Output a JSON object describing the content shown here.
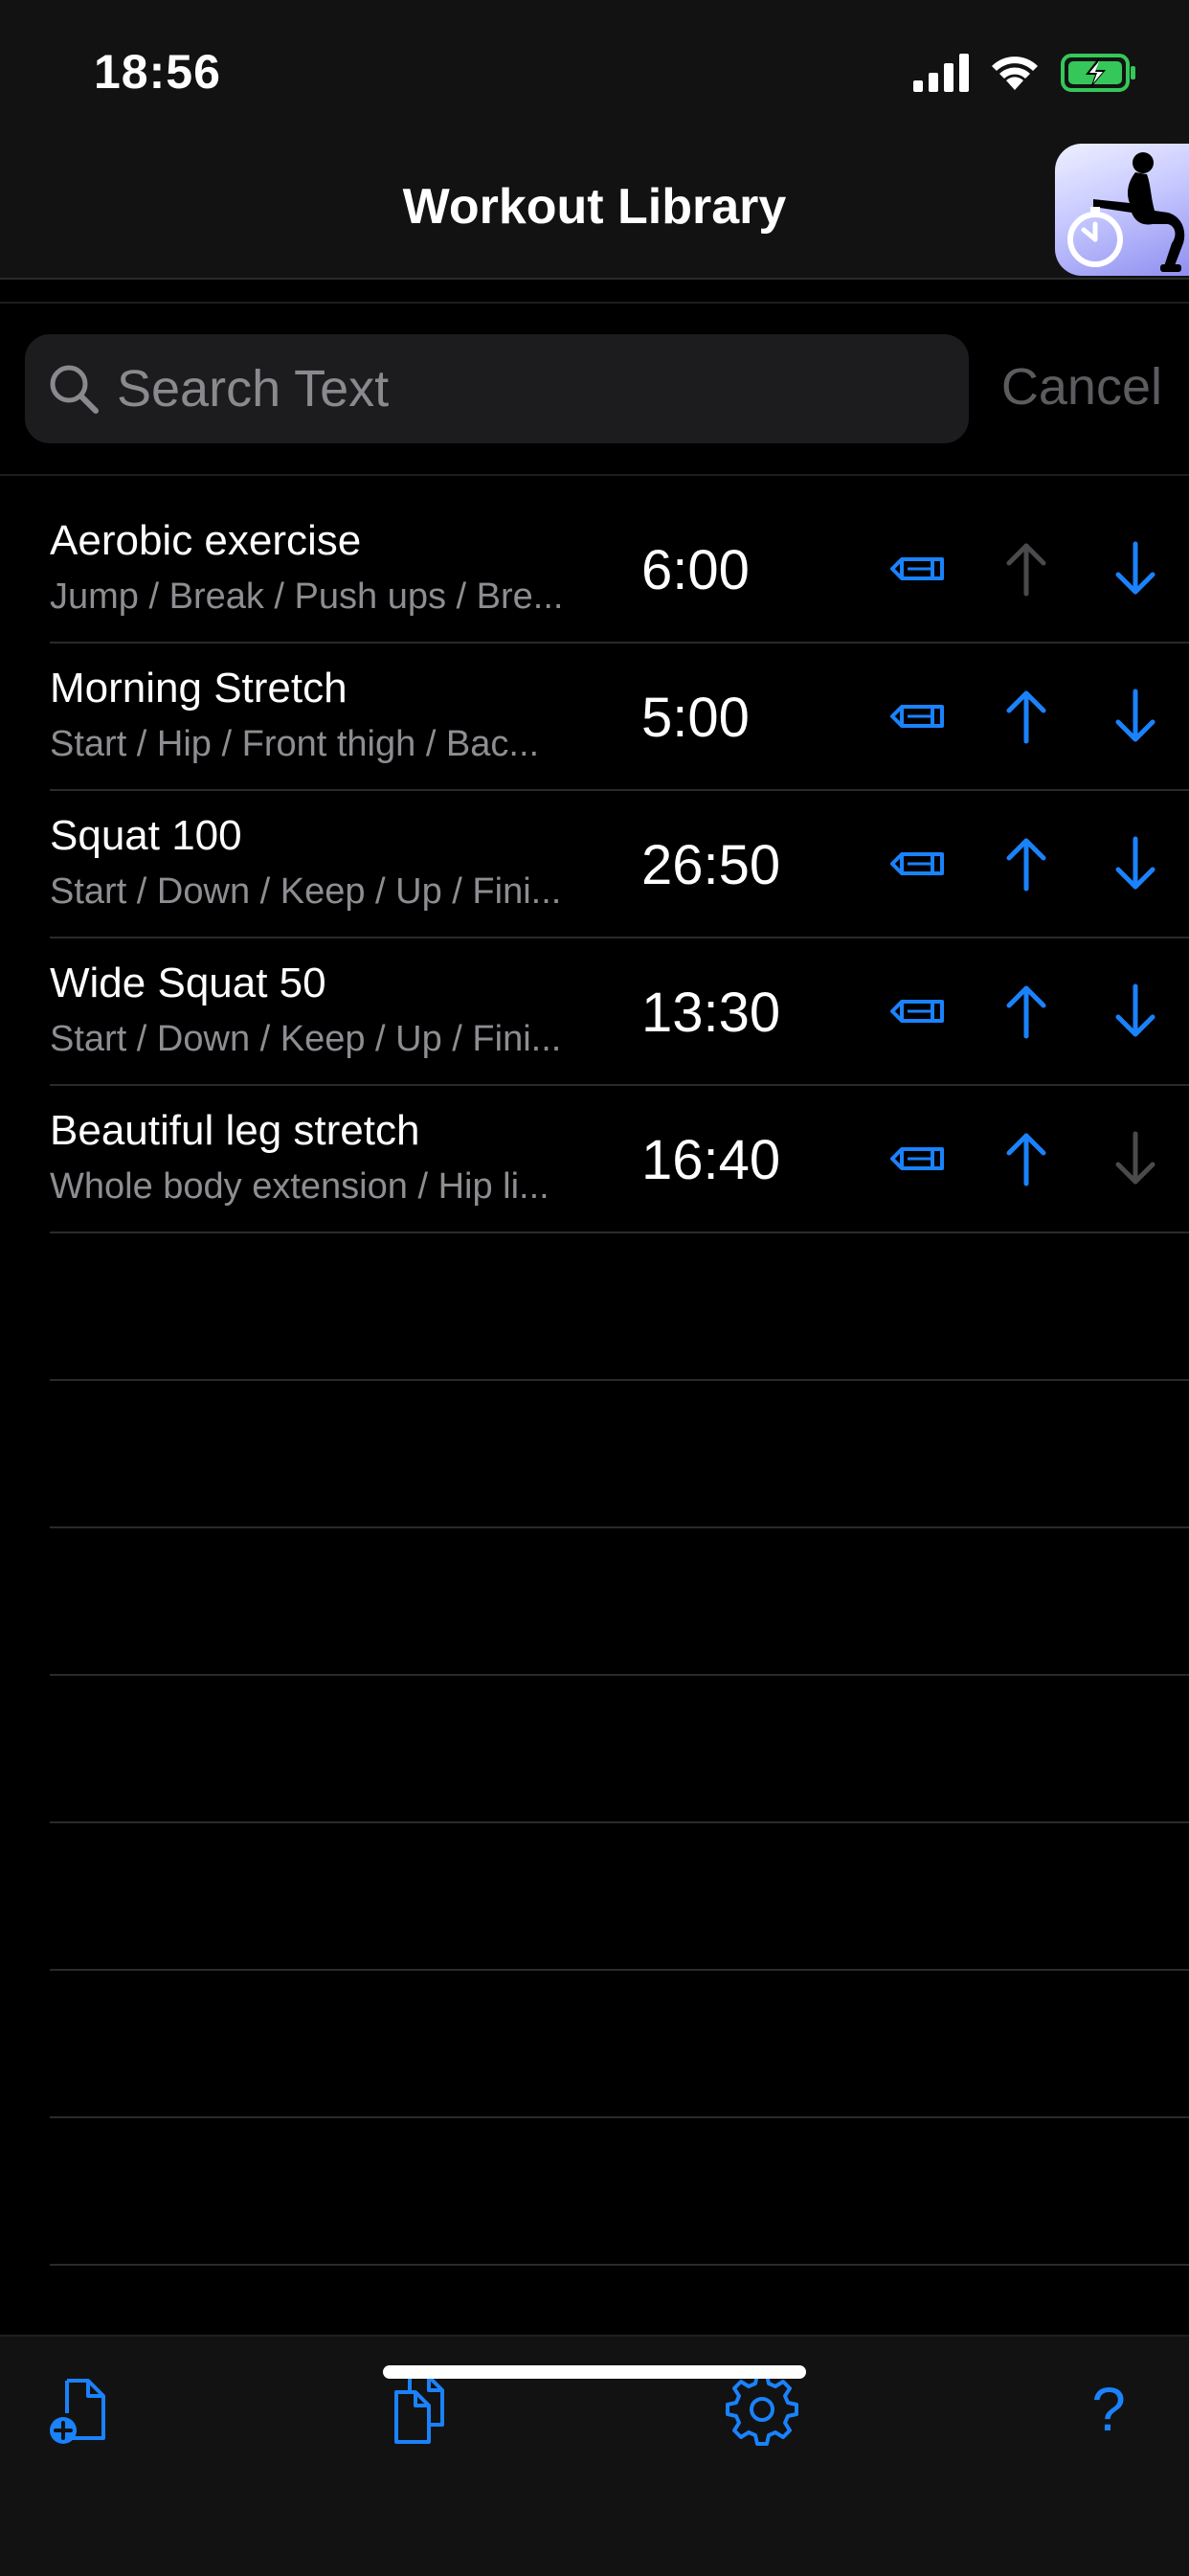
{
  "status_bar": {
    "time": "18:56"
  },
  "nav": {
    "title": "Workout Library"
  },
  "search": {
    "placeholder": "Search Text",
    "cancel_label": "Cancel"
  },
  "workouts": [
    {
      "title": "Aerobic exercise",
      "subtitle": "Jump / Break / Push ups / Bre...",
      "duration": "6:00",
      "up_enabled": false,
      "down_enabled": true
    },
    {
      "title": "Morning Stretch",
      "subtitle": "Start / Hip / Front thigh / Bac...",
      "duration": "5:00",
      "up_enabled": true,
      "down_enabled": true
    },
    {
      "title": "Squat 100",
      "subtitle": "Start / Down / Keep / Up / Fini...",
      "duration": "26:50",
      "up_enabled": true,
      "down_enabled": true
    },
    {
      "title": "Wide Squat 50",
      "subtitle": "Start / Down / Keep / Up / Fini...",
      "duration": "13:30",
      "up_enabled": true,
      "down_enabled": true
    },
    {
      "title": "Beautiful leg stretch",
      "subtitle": "Whole body extension / Hip li...",
      "duration": "16:40",
      "up_enabled": true,
      "down_enabled": false
    }
  ],
  "toolbar": {
    "new_icon": "new-document-icon",
    "duplicate_icon": "duplicate-document-icon",
    "settings_icon": "gear-icon",
    "help_label": "?"
  },
  "colors": {
    "accent": "#1a82fb",
    "disabled": "#4a4a4c",
    "battery": "#35c759"
  }
}
